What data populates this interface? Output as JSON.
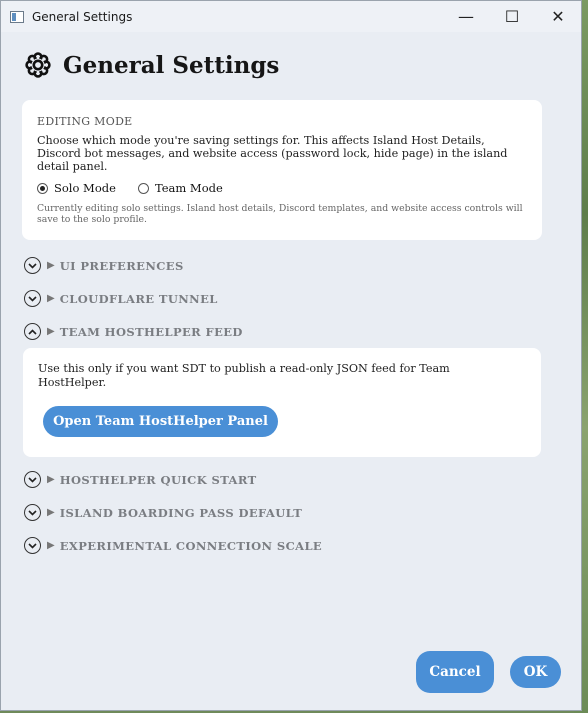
{
  "window": {
    "title": "General Settings",
    "minimize": "—",
    "maximize": "☐",
    "close": "✕"
  },
  "header": {
    "title": "General Settings",
    "icon": "gear-icon"
  },
  "editing_mode": {
    "label": "EDITING MODE",
    "description": "Choose which mode you're saving settings for. This affects Island Host Details, Discord bot messages, and website access (password lock, hide page) in the island detail panel.",
    "options": [
      {
        "label": "Solo Mode",
        "selected": true
      },
      {
        "label": "Team Mode",
        "selected": false
      }
    ],
    "note": "Currently editing solo settings. Island host details, Discord templates, and website access controls will save to the solo profile."
  },
  "sections": [
    {
      "name": "UI PREFERENCES",
      "expanded": false
    },
    {
      "name": "CLOUDFLARE TUNNEL",
      "expanded": false
    },
    {
      "name": "TEAM HOSTHELPER FEED",
      "expanded": true
    },
    {
      "name": "HOSTHELPER QUICK START",
      "expanded": false
    },
    {
      "name": "ISLAND BOARDING PASS DEFAULT",
      "expanded": false
    },
    {
      "name": "EXPERIMENTAL CONNECTION SCALE",
      "expanded": false
    }
  ],
  "team_feed": {
    "description": "Use this only if you want SDT to publish a read-only JSON feed for Team HostHelper.",
    "button": "Open Team HostHelper Panel"
  },
  "footer": {
    "cancel": "Cancel",
    "ok": "OK"
  },
  "colors": {
    "accent": "#4a8fd6",
    "window_bg": "#e9edf3",
    "card_bg": "#ffffff"
  }
}
